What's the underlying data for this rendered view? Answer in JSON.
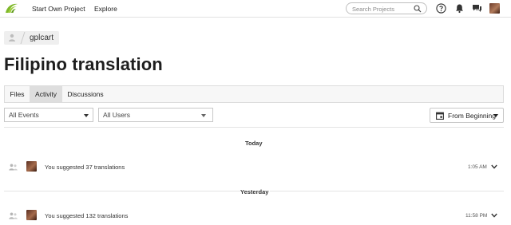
{
  "nav": {
    "links": [
      "Start Own Project",
      "Explore"
    ],
    "search_placeholder": "Search Projects"
  },
  "breadcrumb": {
    "name": "gplcart"
  },
  "page": {
    "title": "Filipino translation"
  },
  "tabs": [
    {
      "label": "Files",
      "active": false
    },
    {
      "label": "Activity",
      "active": true
    },
    {
      "label": "Discussions",
      "active": false
    }
  ],
  "filters": {
    "events": "All Events",
    "users": "All Users",
    "from": "From Beginning"
  },
  "activity": [
    {
      "day": "Today",
      "text": "You suggested 37 translations",
      "time": "1:05 AM"
    },
    {
      "day": "Yesterday",
      "text": "You suggested 132 translations",
      "time": "11:58 PM"
    }
  ],
  "colors": {
    "logo_green": "#7fb82a",
    "accent_border": "#dcdcdc"
  }
}
